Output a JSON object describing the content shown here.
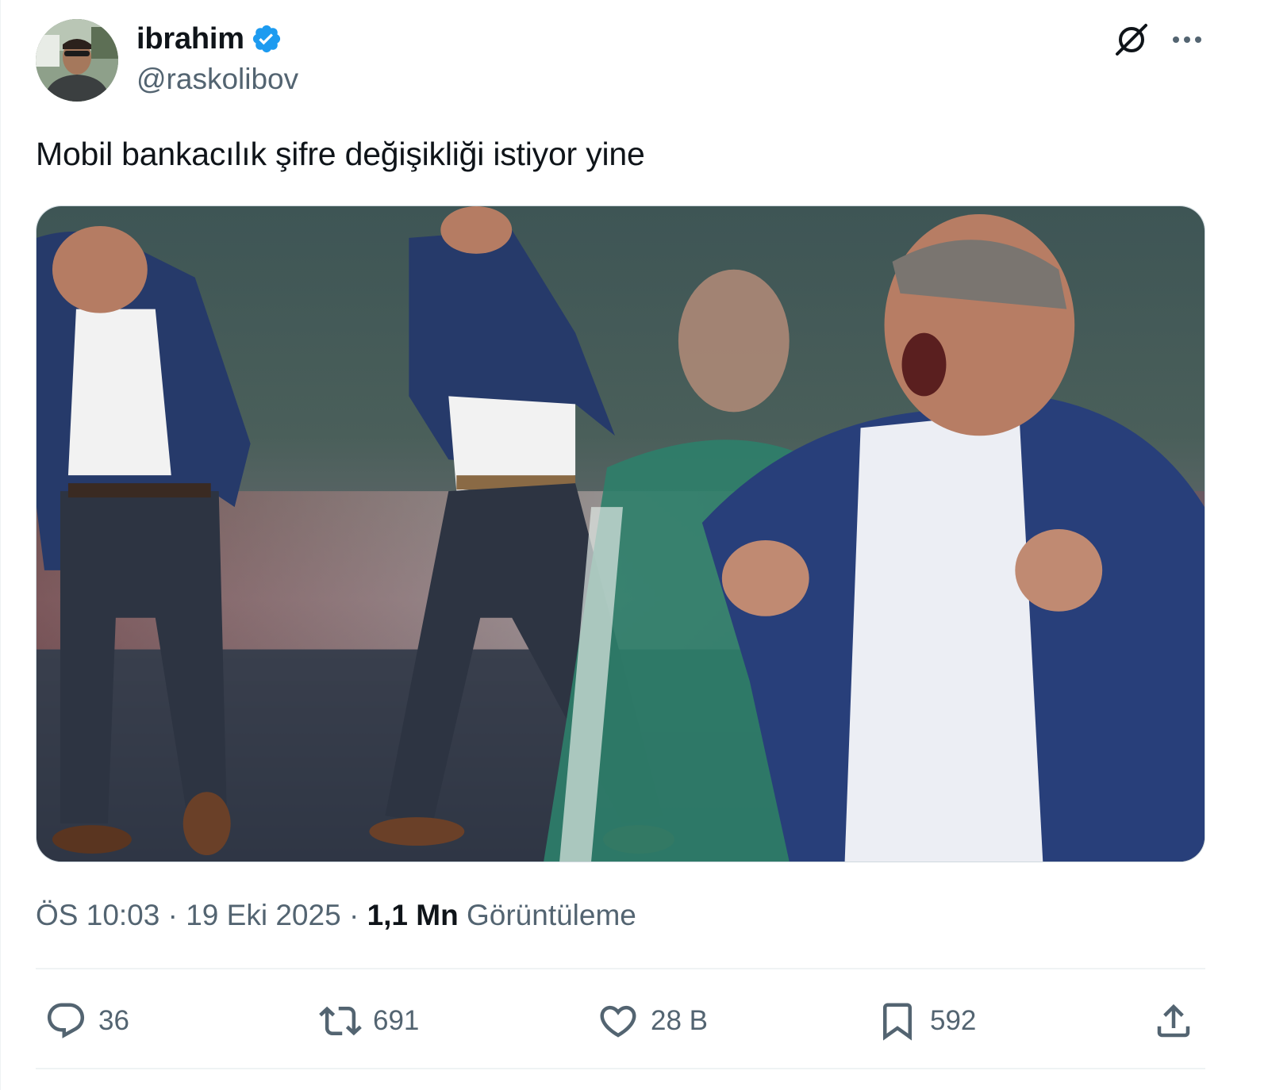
{
  "author": {
    "display_name": "ibrahim",
    "handle": "@raskolibov",
    "verified": true,
    "verified_color": "#1d9bf0"
  },
  "header_actions": {
    "grok_icon": "grok-icon",
    "more_icon": "more-icon"
  },
  "tweet": {
    "text": "Mobil bankacılık şifre değişikliği istiyor yine"
  },
  "meta": {
    "time": "ÖS 10:03",
    "separator": "·",
    "date": "19 Eki 2025",
    "views_count": "1,1 Mn",
    "views_label": "Görüntüleme"
  },
  "actions": {
    "reply": {
      "icon": "reply-icon",
      "count": "36"
    },
    "repost": {
      "icon": "repost-icon",
      "count": "691"
    },
    "like": {
      "icon": "heart-icon",
      "count": "28 B"
    },
    "bookmark": {
      "icon": "bookmark-icon",
      "count": "592"
    },
    "share": {
      "icon": "share-icon"
    }
  },
  "colors": {
    "text_primary": "#0f1419",
    "text_secondary": "#536471",
    "divider": "#eff3f4"
  }
}
